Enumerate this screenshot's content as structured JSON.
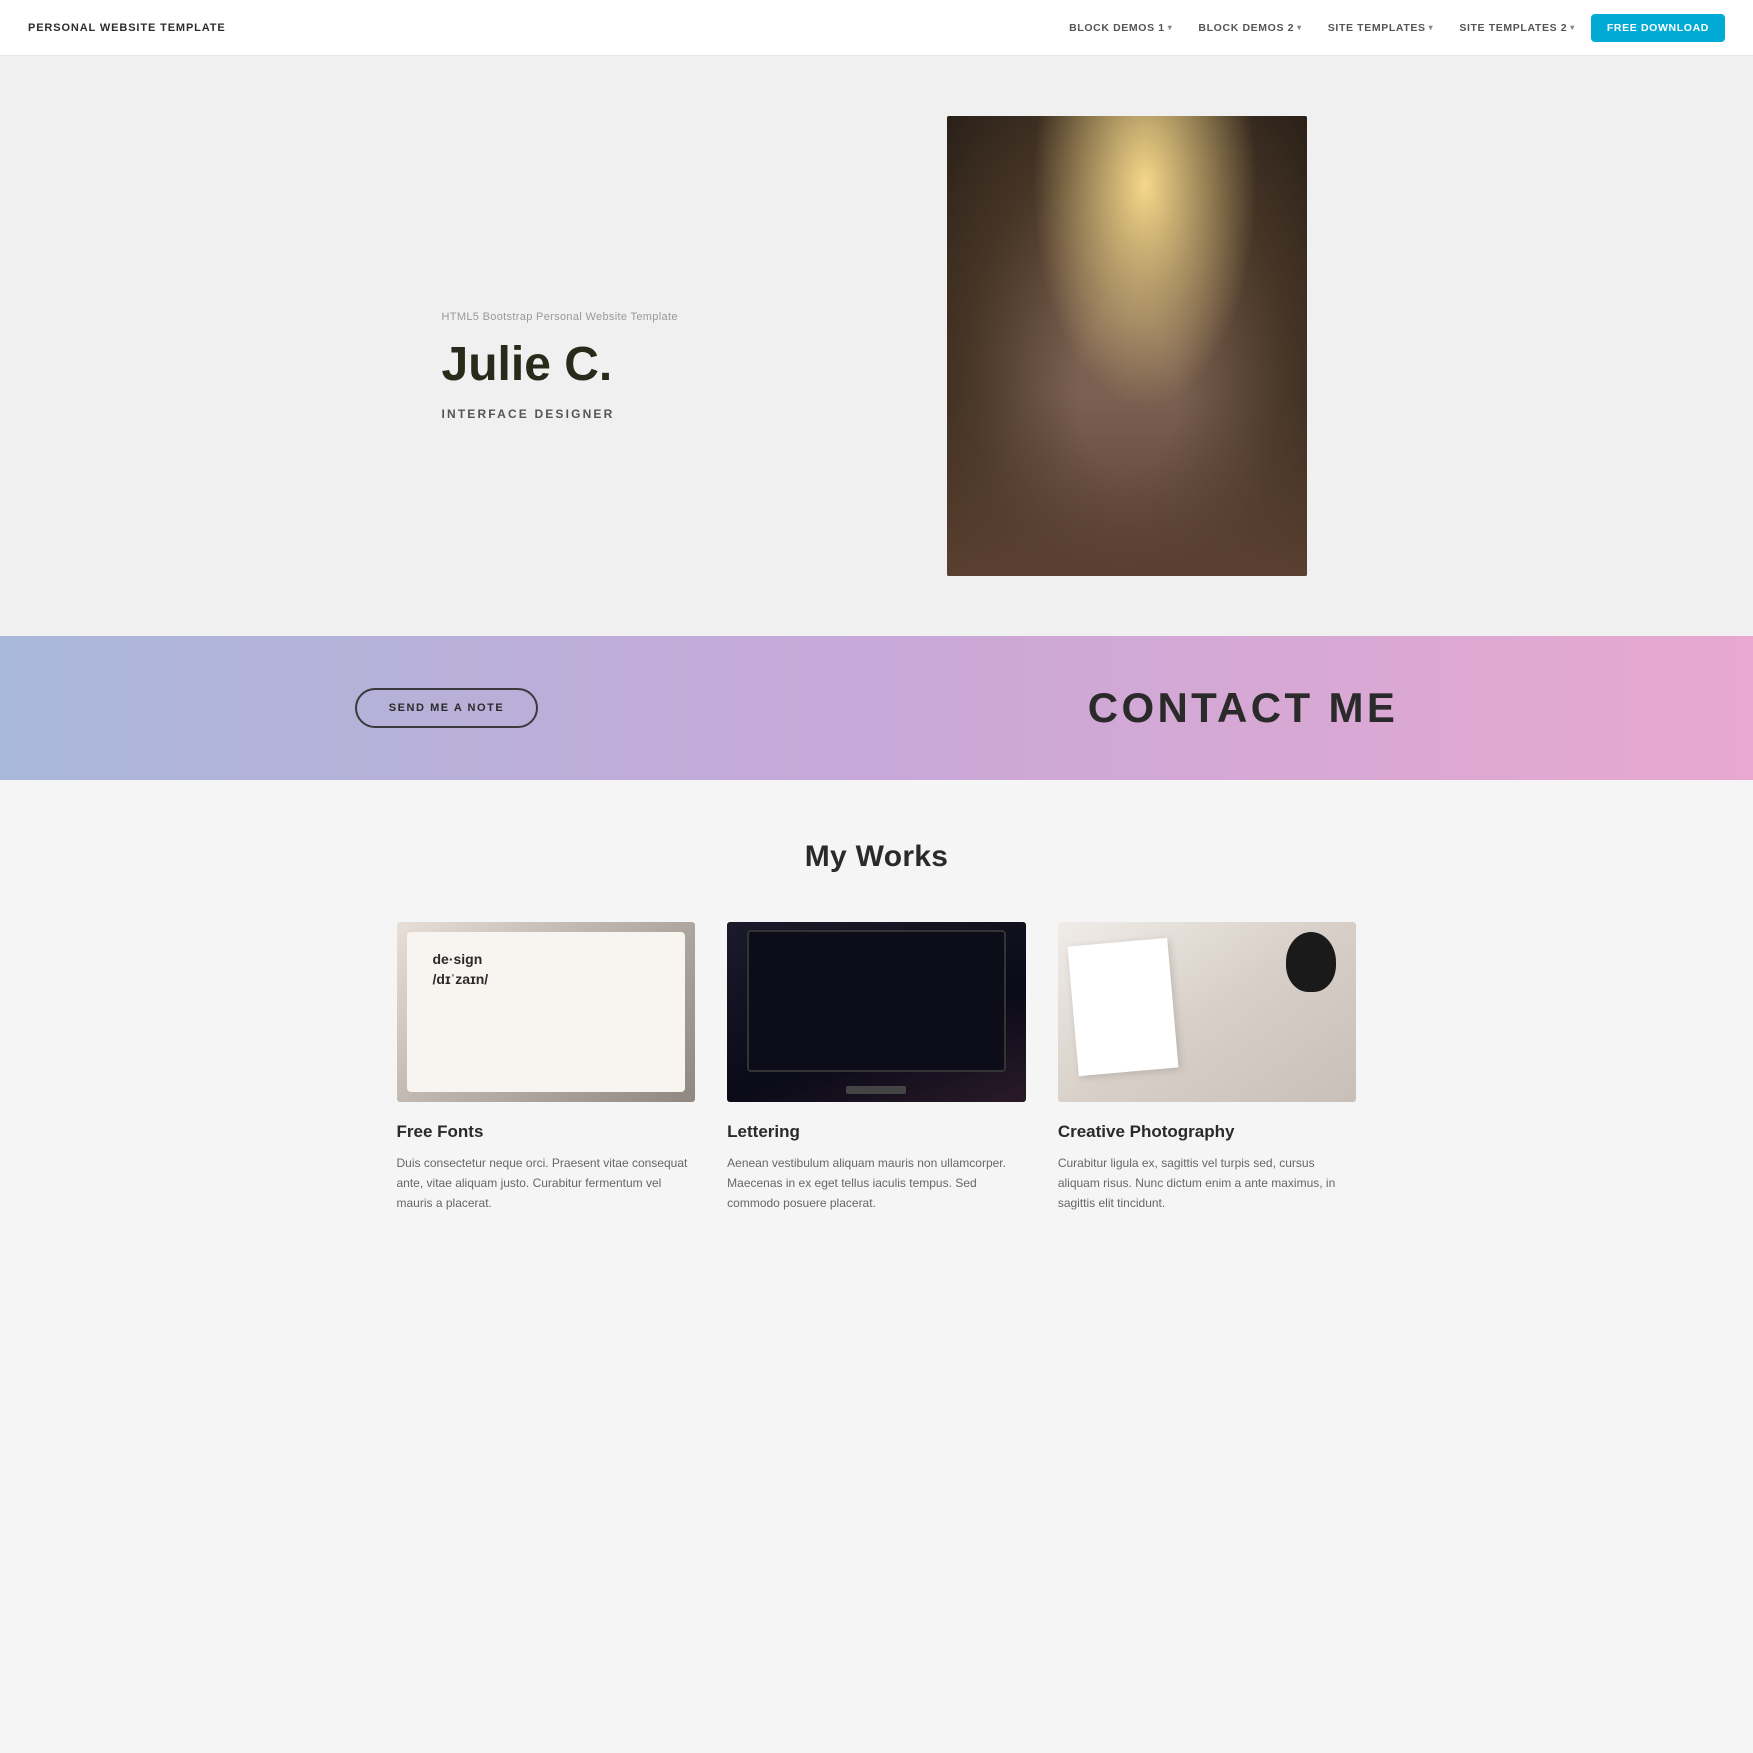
{
  "navbar": {
    "brand": "PERSONAL WEBSITE TEMPLATE",
    "nav_items": [
      {
        "label": "BLOCK DEMOS 1",
        "has_caret": true
      },
      {
        "label": "BLOCK DEMOS 2",
        "has_caret": true
      },
      {
        "label": "SITE TEMPLATES",
        "has_caret": true
      },
      {
        "label": "SITE TEMPLATES 2",
        "has_caret": true
      }
    ],
    "cta_label": "FREE DOWNLOAD"
  },
  "hero": {
    "subtitle": "HTML5 Bootstrap Personal Website Template",
    "name": "Julie C.",
    "role_prefix": "IN",
    "role_highlighted": "T",
    "role_suffix": "ERFACE DESIGNER",
    "role_full": "INTERFACE DESIGNER"
  },
  "contact": {
    "button_label": "SEND ME A NOTE",
    "title": "CONTACT ME"
  },
  "works": {
    "section_title": "My Works",
    "cards": [
      {
        "title": "Free Fonts",
        "description": "Duis consectetur neque orci. Praesent vitae consequat ante, vitae aliquam justo. Curabitur fermentum vel mauris a placerat."
      },
      {
        "title": "Lettering",
        "description": "Aenean vestibulum aliquam mauris non ullamcorper. Maecenas in ex eget tellus iaculis tempus. Sed commodo posuere placerat."
      },
      {
        "title": "Creative Photography",
        "description": "Curabitur ligula ex, sagittis vel turpis sed, cursus aliquam risus. Nunc dictum enim a ante maximus, in sagittis elit tincidunt."
      }
    ]
  }
}
